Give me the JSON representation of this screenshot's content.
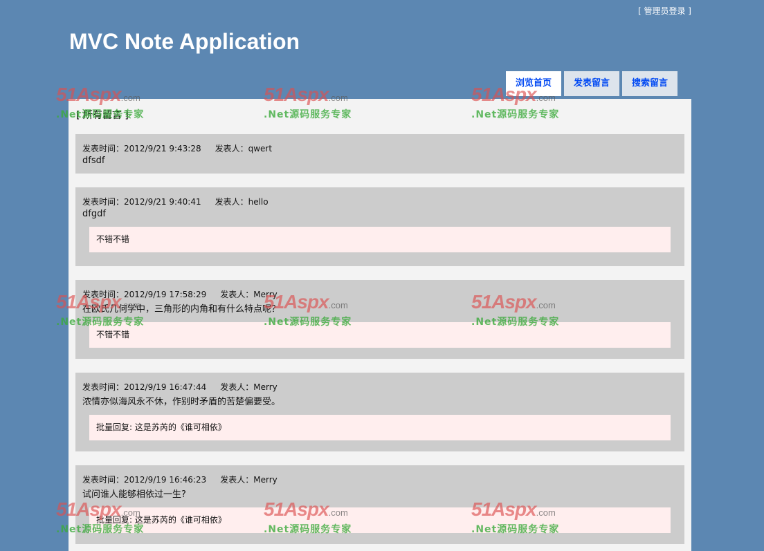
{
  "header": {
    "login_link": "[ 管理员登录 ]",
    "title": "MVC Note Application"
  },
  "menu": {
    "items": [
      {
        "label": "浏览首页"
      },
      {
        "label": "发表留言"
      },
      {
        "label": "搜索留言"
      }
    ]
  },
  "main": {
    "section_label": "[ 所有留言 ]",
    "notes": [
      {
        "time": "发表时间：2012/9/21 9:43:28",
        "author": "发表人：qwert",
        "content": "dfsdf",
        "reply": null
      },
      {
        "time": "发表时间：2012/9/21 9:40:41",
        "author": "发表人：hello",
        "content": "dfgdf",
        "reply": "不错不错"
      },
      {
        "time": "发表时间：2012/9/19 17:58:29",
        "author": "发表人：Merry",
        "content": "在欧氏几何学中，三角形的内角和有什么特点呢？",
        "reply": "不错不错"
      },
      {
        "time": "发表时间：2012/9/19 16:47:44",
        "author": "发表人：Merry",
        "content": "浓情亦似海风永不休，作别时矛盾的苦楚偏要受。",
        "reply": "批量回复: 这是苏芮的《谁可相依》"
      },
      {
        "time": "发表时间：2012/9/19 16:46:23",
        "author": "发表人：Merry",
        "content": "试问谁人能够相依过一生?",
        "reply": "批量回复: 这是苏芮的《谁可相依》"
      }
    ]
  },
  "watermark": {
    "brand": "51Aspx",
    "suffix": ".com",
    "slogan": ".Net源码服务专家"
  },
  "colors": {
    "background": "#5c87b2",
    "content_bg": "#f3f3f3",
    "note_bg": "#cccccc",
    "reply_bg": "#ffeeee",
    "menu_text": "#034af3"
  }
}
